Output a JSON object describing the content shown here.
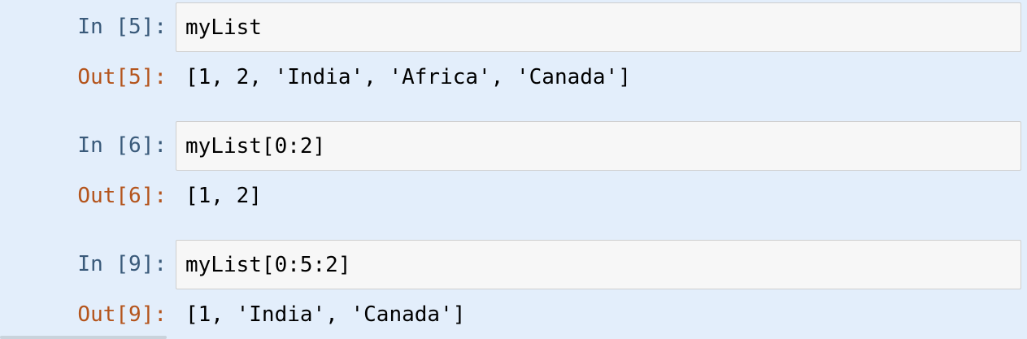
{
  "cells": [
    {
      "in_prompt": "In [5]:",
      "code": "myList",
      "out_prompt": "Out[5]:",
      "output": "[1, 2, 'India', 'Africa', 'Canada']"
    },
    {
      "in_prompt": "In [6]:",
      "code": "myList[0:2]",
      "out_prompt": "Out[6]:",
      "output": "[1, 2]"
    },
    {
      "in_prompt": "In [9]:",
      "code": "myList[0:5:2]",
      "out_prompt": "Out[9]:",
      "output": "[1, 'India', 'Canada']"
    }
  ],
  "colors": {
    "background": "#e3eefb",
    "in_prompt": "#3a5a7a",
    "out_prompt": "#b4541c",
    "input_bg": "#f7f7f7",
    "input_border": "#cfcfcf"
  }
}
